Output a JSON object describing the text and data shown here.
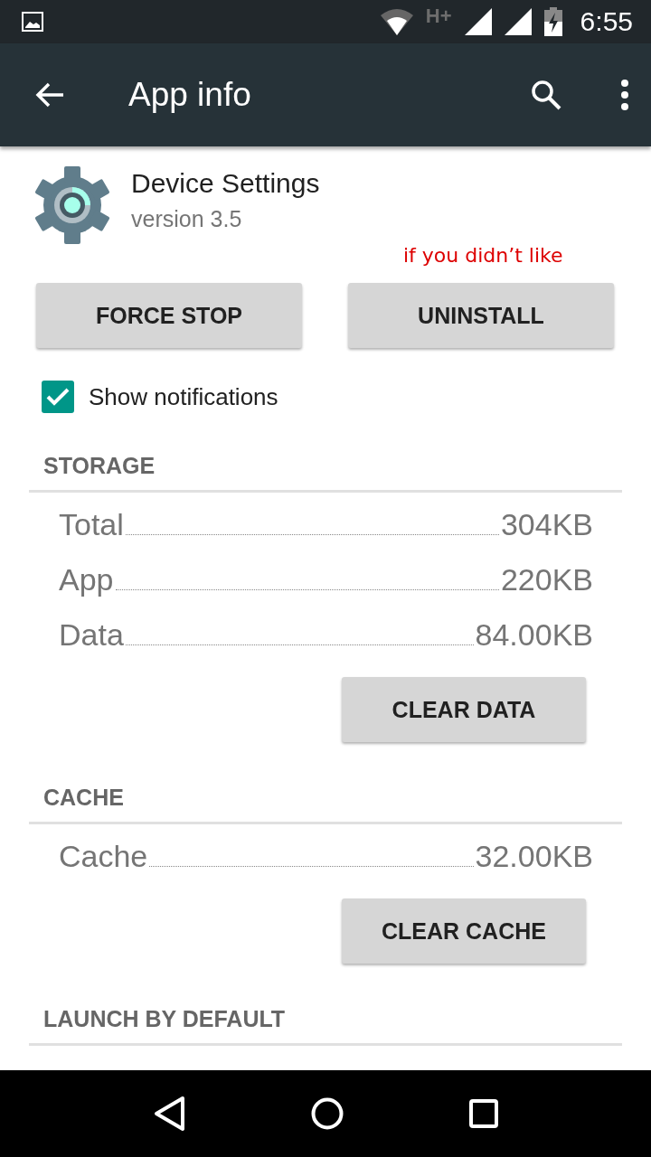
{
  "status_bar": {
    "network": "H+",
    "time": "6:55"
  },
  "toolbar": {
    "title": "App info"
  },
  "app": {
    "name": "Device Settings",
    "version": "version 3.5"
  },
  "annotation": "if you didn’t like",
  "buttons": [
    "FORCE STOP",
    "UNINSTALL"
  ],
  "notifications": {
    "label": "Show notifications",
    "checked": true
  },
  "sections": [
    {
      "title": "STORAGE",
      "rows": [
        {
          "label": "Total",
          "value": "304KB"
        },
        {
          "label": "App",
          "value": "220KB"
        },
        {
          "label": "Data",
          "value": "84.00KB"
        }
      ],
      "button": "CLEAR DATA"
    },
    {
      "title": "CACHE",
      "rows": [
        {
          "label": "Cache",
          "value": "32.00KB"
        }
      ],
      "button": "CLEAR CACHE"
    },
    {
      "title": "LAUNCH BY DEFAULT"
    }
  ]
}
